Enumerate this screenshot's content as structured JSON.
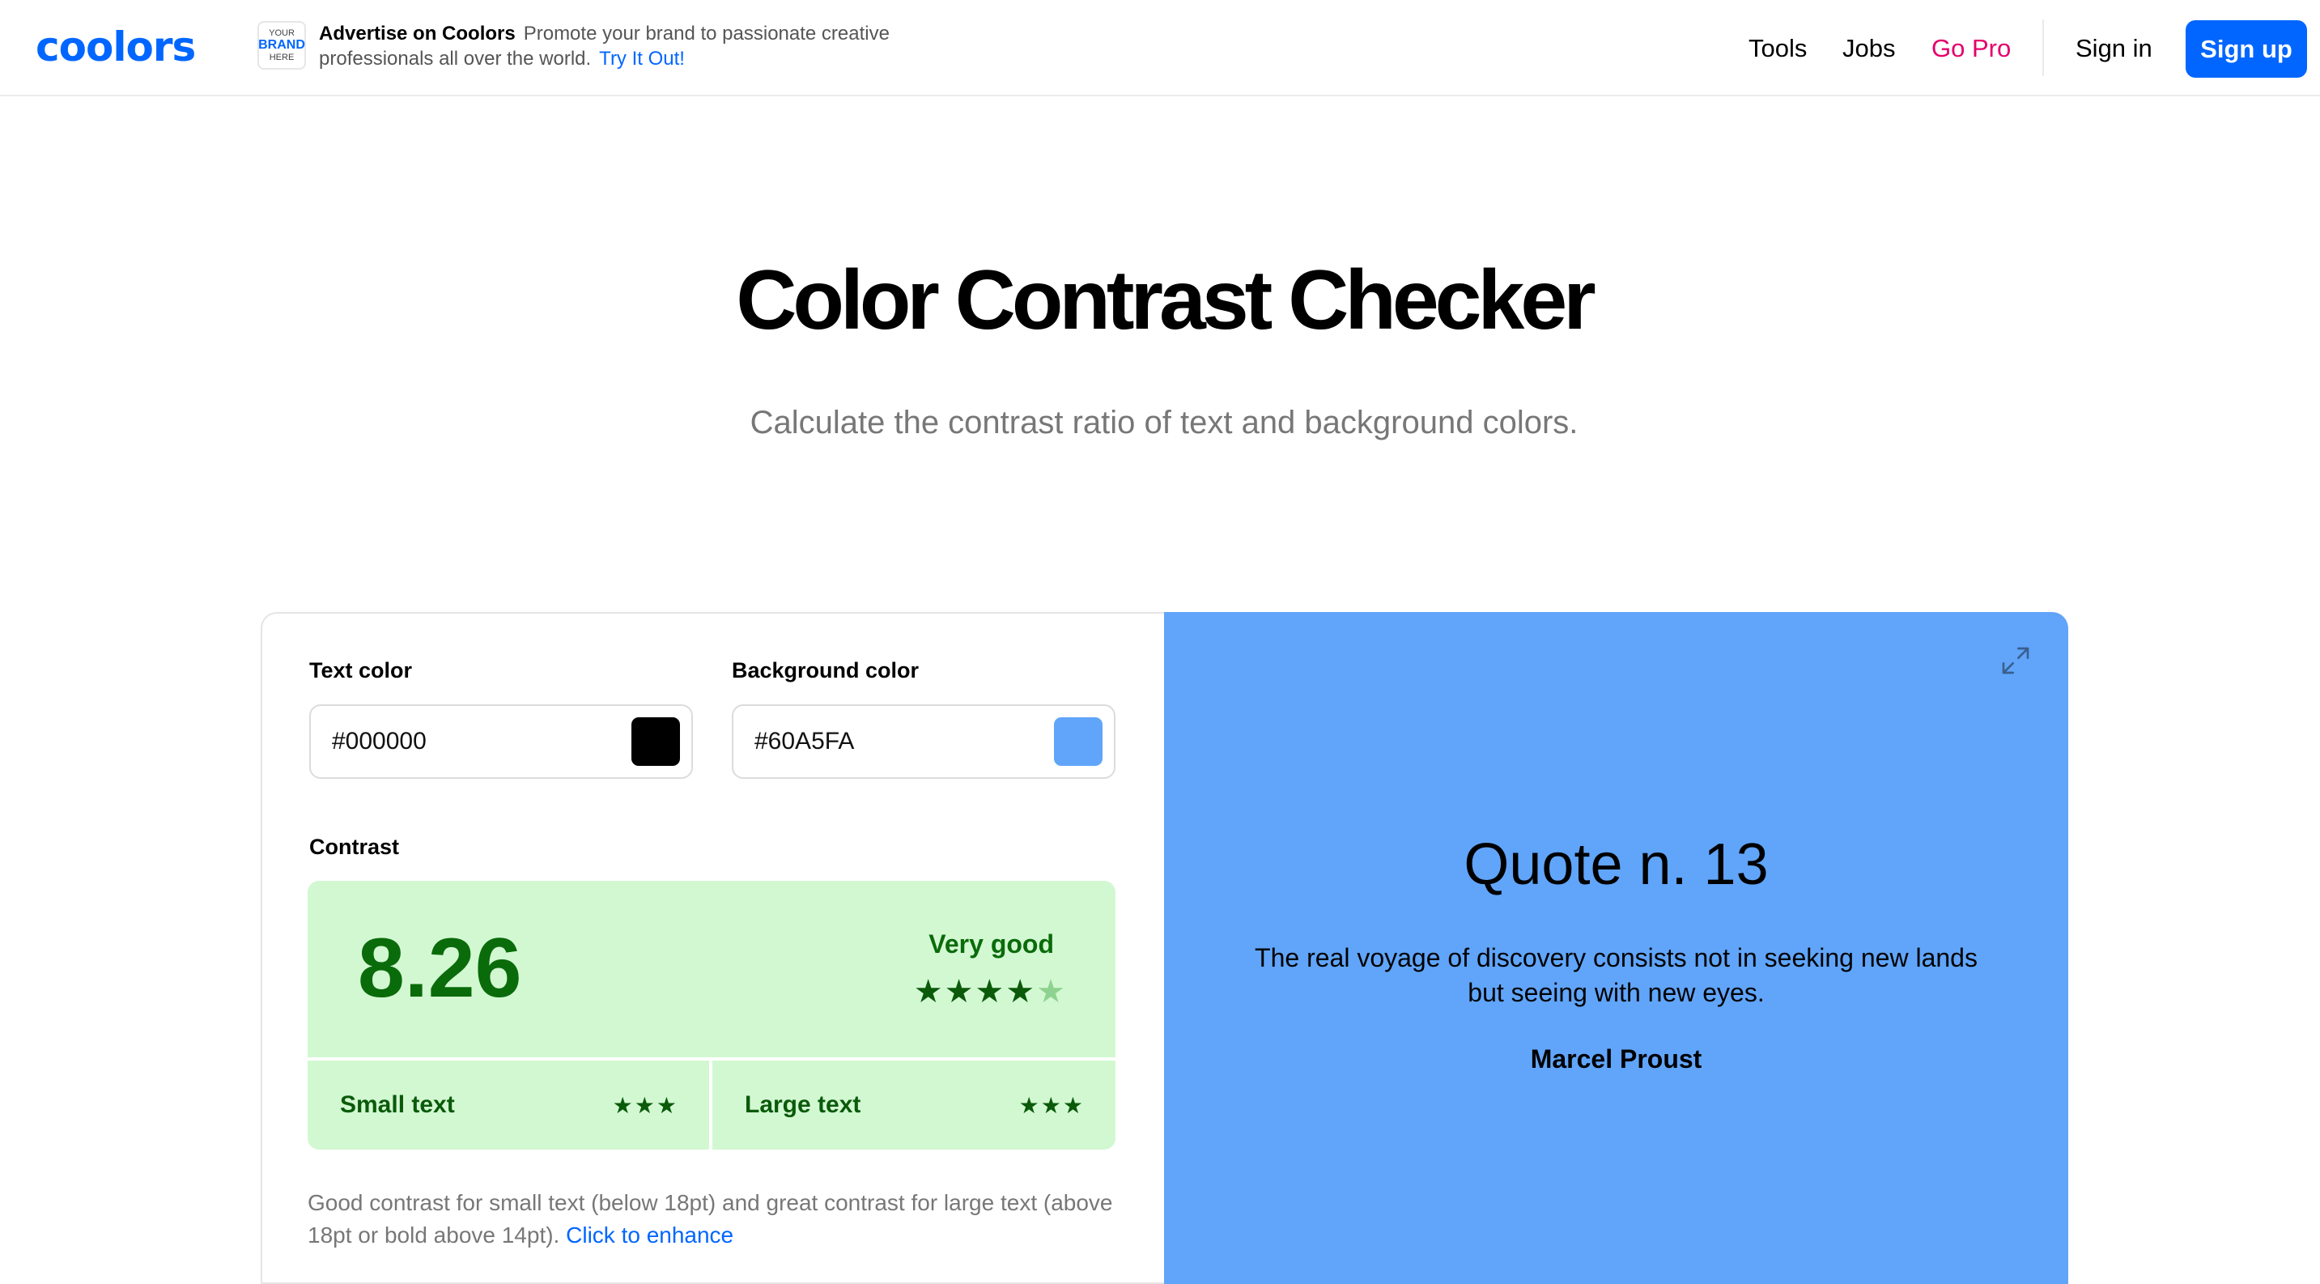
{
  "header": {
    "logo": "coolors",
    "ad": {
      "badge_top": "YOUR",
      "badge_brand": "BRAND",
      "badge_bottom": "HERE",
      "title": "Advertise on Coolors",
      "text": "Promote your brand to passionate creative professionals all over the world.",
      "link": "Try It Out!"
    },
    "nav": {
      "tools": "Tools",
      "jobs": "Jobs",
      "go_pro": "Go Pro",
      "sign_in": "Sign in",
      "sign_up": "Sign up"
    }
  },
  "hero": {
    "title": "Color Contrast Checker",
    "subtitle": "Calculate the contrast ratio of text and background colors."
  },
  "checker": {
    "text_color_label": "Text color",
    "text_color_value": "#000000",
    "background_color_label": "Background color",
    "background_color_value": "#60A5FA",
    "contrast_label": "Contrast",
    "contrast_value": "8.26",
    "rating": "Very good",
    "rating_stars": 4,
    "rating_stars_max": 5,
    "small_text_label": "Small text",
    "small_text_stars": 3,
    "large_text_label": "Large text",
    "large_text_stars": 3,
    "description": "Good contrast for small text (below 18pt) and great contrast for large text (above 18pt or bold above 14pt).",
    "enhance_link": "Click to enhance"
  },
  "preview": {
    "quote_title": "Quote n. 13",
    "quote_text": "The real voyage of discovery consists not in seeking new lands but seeing with new eyes.",
    "author": "Marcel Proust"
  },
  "colors": {
    "accent": "#0066ff",
    "go_pro": "#e4006b",
    "text_color": "#000000",
    "background_color": "#60a5fa",
    "score_bg": "#d2f8d2",
    "score_text": "#0a6b0a"
  }
}
